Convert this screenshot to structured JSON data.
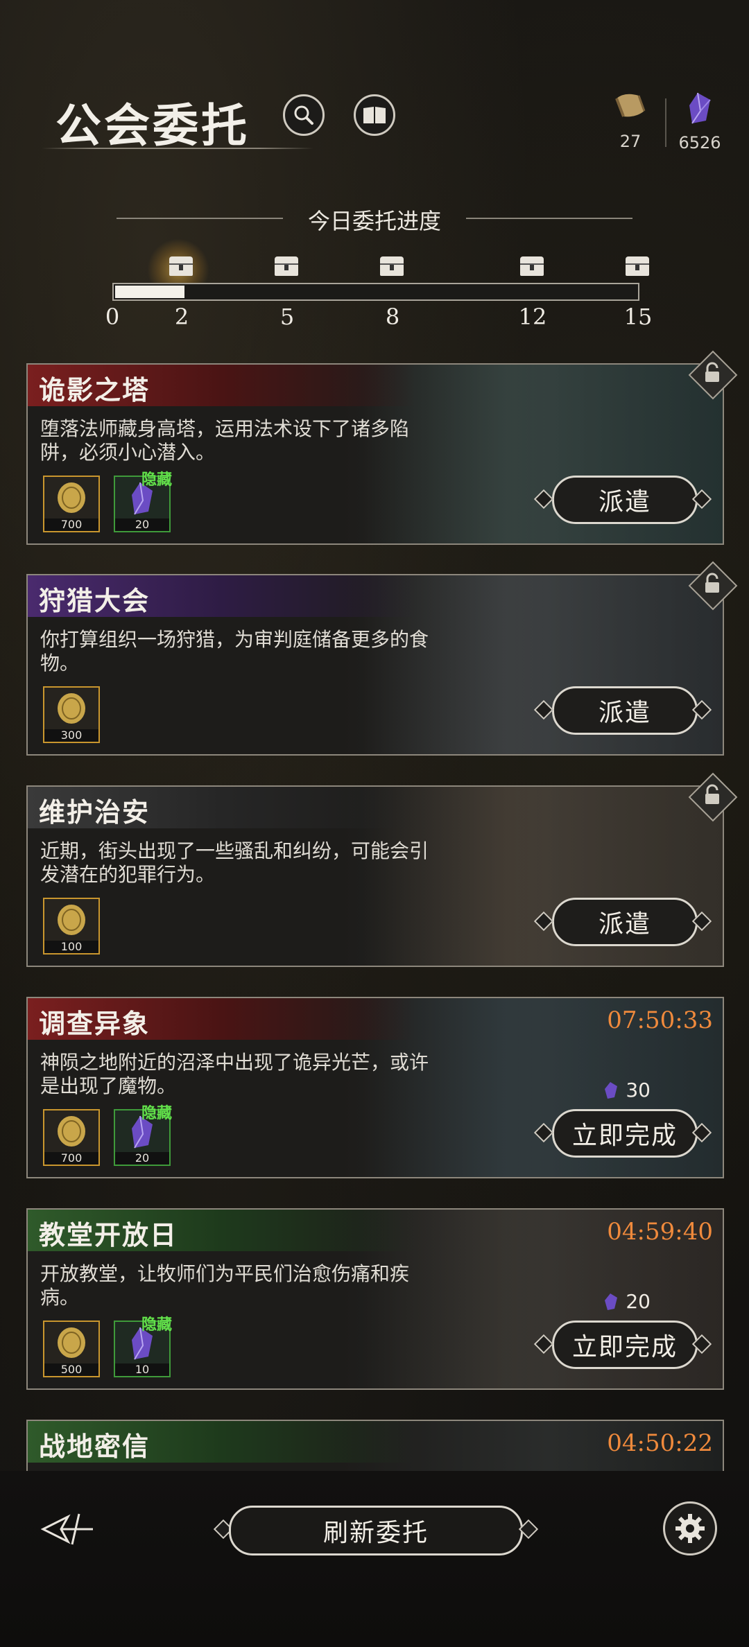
{
  "header": {
    "title": "公会委托",
    "resources": [
      {
        "icon": "scroll-icon",
        "value": "27"
      },
      {
        "icon": "crystal-icon",
        "value": "6526"
      }
    ]
  },
  "progress": {
    "title": "今日委托进度",
    "current": 2,
    "max": 15,
    "milestones": [
      "2",
      "5",
      "8",
      "12",
      "15"
    ],
    "start_label": "0"
  },
  "quests": [
    {
      "name": "诡影之塔",
      "desc_line1": "堕落法师藏身高塔，运用法术设下了诸多陷",
      "desc_line2": "阱，必须小心潜入。",
      "rewards": [
        {
          "amount": "700",
          "type": "coin"
        },
        {
          "amount": "20",
          "type": "crystal",
          "tag": "隐藏"
        }
      ],
      "action": "派遣",
      "header_color": "#7a1f1f",
      "locked": true
    },
    {
      "name": "狩猎大会",
      "desc_line1": "你打算组织一场狩猎，为审判庭储备更多的食",
      "desc_line2": "物。",
      "rewards": [
        {
          "amount": "300",
          "type": "coin"
        }
      ],
      "action": "派遣",
      "header_color": "#4a2a6e",
      "locked": true
    },
    {
      "name": "维护治安",
      "desc_line1": "近期，街头出现了一些骚乱和纠纷，可能会引",
      "desc_line2": "发潜在的犯罪行为。",
      "rewards": [
        {
          "amount": "100",
          "type": "coin"
        }
      ],
      "action": "派遣",
      "header_color": "#3a3a3a",
      "locked": true
    },
    {
      "name": "调查异象",
      "timer": "07:50:33",
      "desc_line1": "神陨之地附近的沼泽中出现了诡异光芒，或许",
      "desc_line2": "是出现了魔物。",
      "rewards": [
        {
          "amount": "700",
          "type": "coin"
        },
        {
          "amount": "20",
          "type": "crystal",
          "tag": "隐藏"
        }
      ],
      "cost": "30",
      "action": "立即完成",
      "header_color": "#7a1f1f"
    },
    {
      "name": "教堂开放日",
      "timer": "04:59:40",
      "desc_line1": "开放教堂，让牧师们为平民们治愈伤痛和疾",
      "desc_line2": "病。",
      "rewards": [
        {
          "amount": "500",
          "type": "coin"
        },
        {
          "amount": "10",
          "type": "crystal",
          "tag": "隐藏"
        }
      ],
      "cost": "20",
      "action": "立即完成",
      "header_color": "#2f5a2a"
    },
    {
      "name": "战地密信",
      "timer": "04:50:22",
      "header_color": "#2f5a2a"
    }
  ],
  "bottom": {
    "refresh_label": "刷新委托"
  }
}
